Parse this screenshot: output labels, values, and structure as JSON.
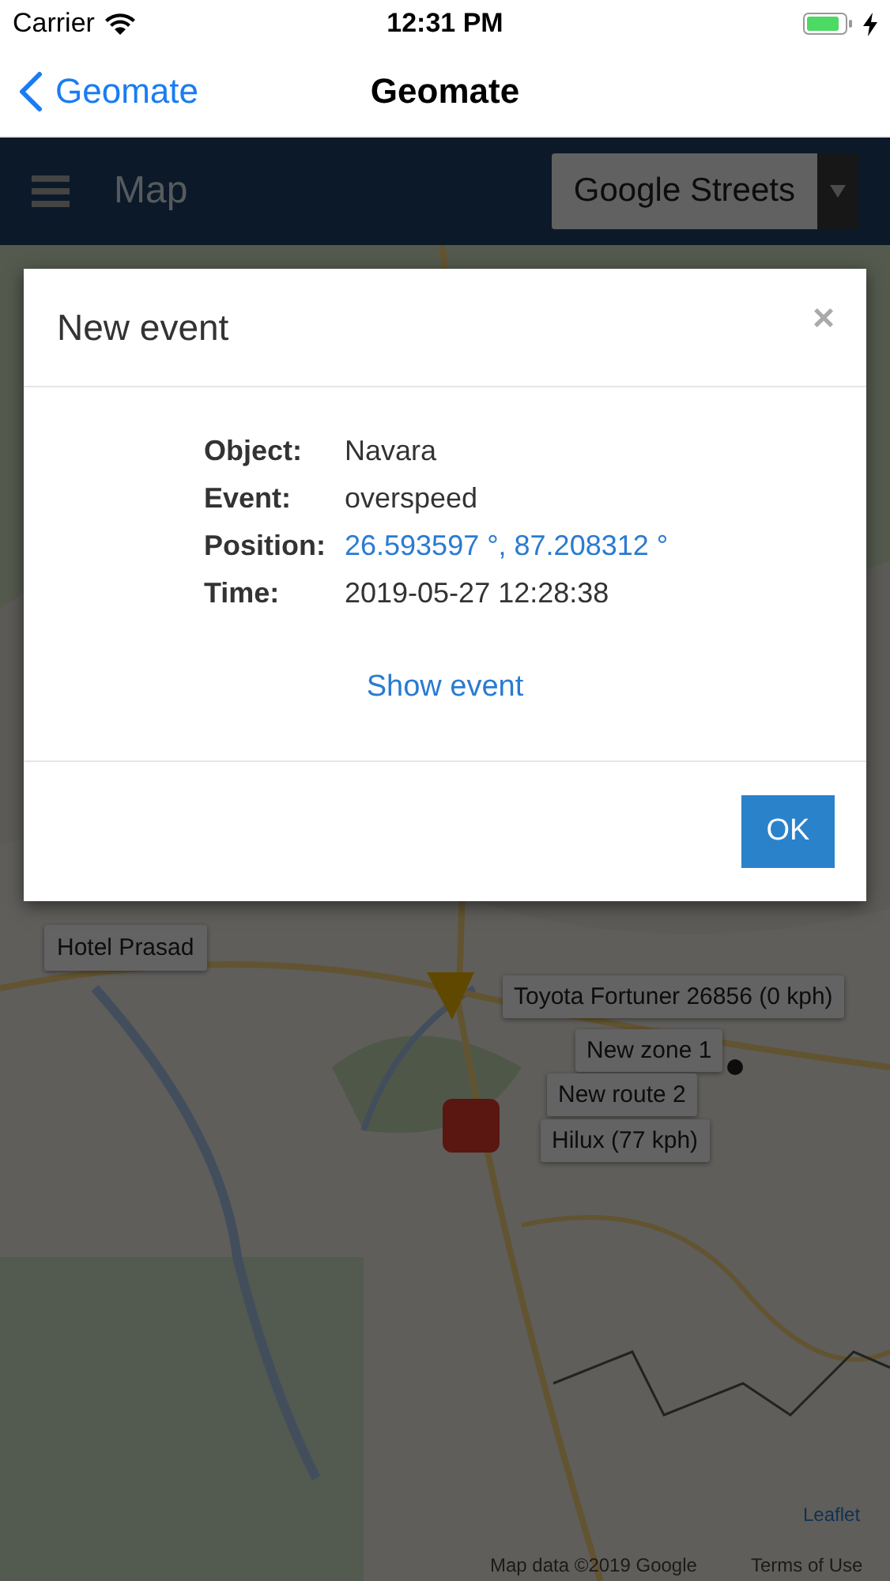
{
  "status_bar": {
    "carrier": "Carrier",
    "time": "12:31 PM"
  },
  "nav_bar": {
    "back": "Geomate",
    "title": "Geomate"
  },
  "app_header": {
    "title": "Map",
    "layer_select": "Google Streets"
  },
  "map": {
    "markers": [
      {
        "kind": "poi",
        "label": "Hotel Prasad"
      },
      {
        "kind": "vehicle",
        "label": "Toyota Fortuner 26856 (0 kph)"
      },
      {
        "kind": "zone",
        "label": "New zone 1"
      },
      {
        "kind": "route",
        "label": "New route 2"
      },
      {
        "kind": "vehicle",
        "label": "Hilux (77 kph)"
      }
    ],
    "attribution": {
      "leaflet": "Leaflet",
      "map_data": "Map data ©2019 Google",
      "terms": "Terms of Use"
    }
  },
  "dialog": {
    "title": "New event",
    "close": "×",
    "fields": [
      {
        "label": "Object:",
        "value": "Navara",
        "kind": "text"
      },
      {
        "label": "Event:",
        "value": "overspeed",
        "kind": "text"
      },
      {
        "label": "Position:",
        "value": "26.593597 °, 87.208312 °",
        "kind": "link"
      },
      {
        "label": "Time:",
        "value": "2019-05-27 12:28:38",
        "kind": "text"
      }
    ],
    "link": "Show event",
    "button": "OK"
  }
}
